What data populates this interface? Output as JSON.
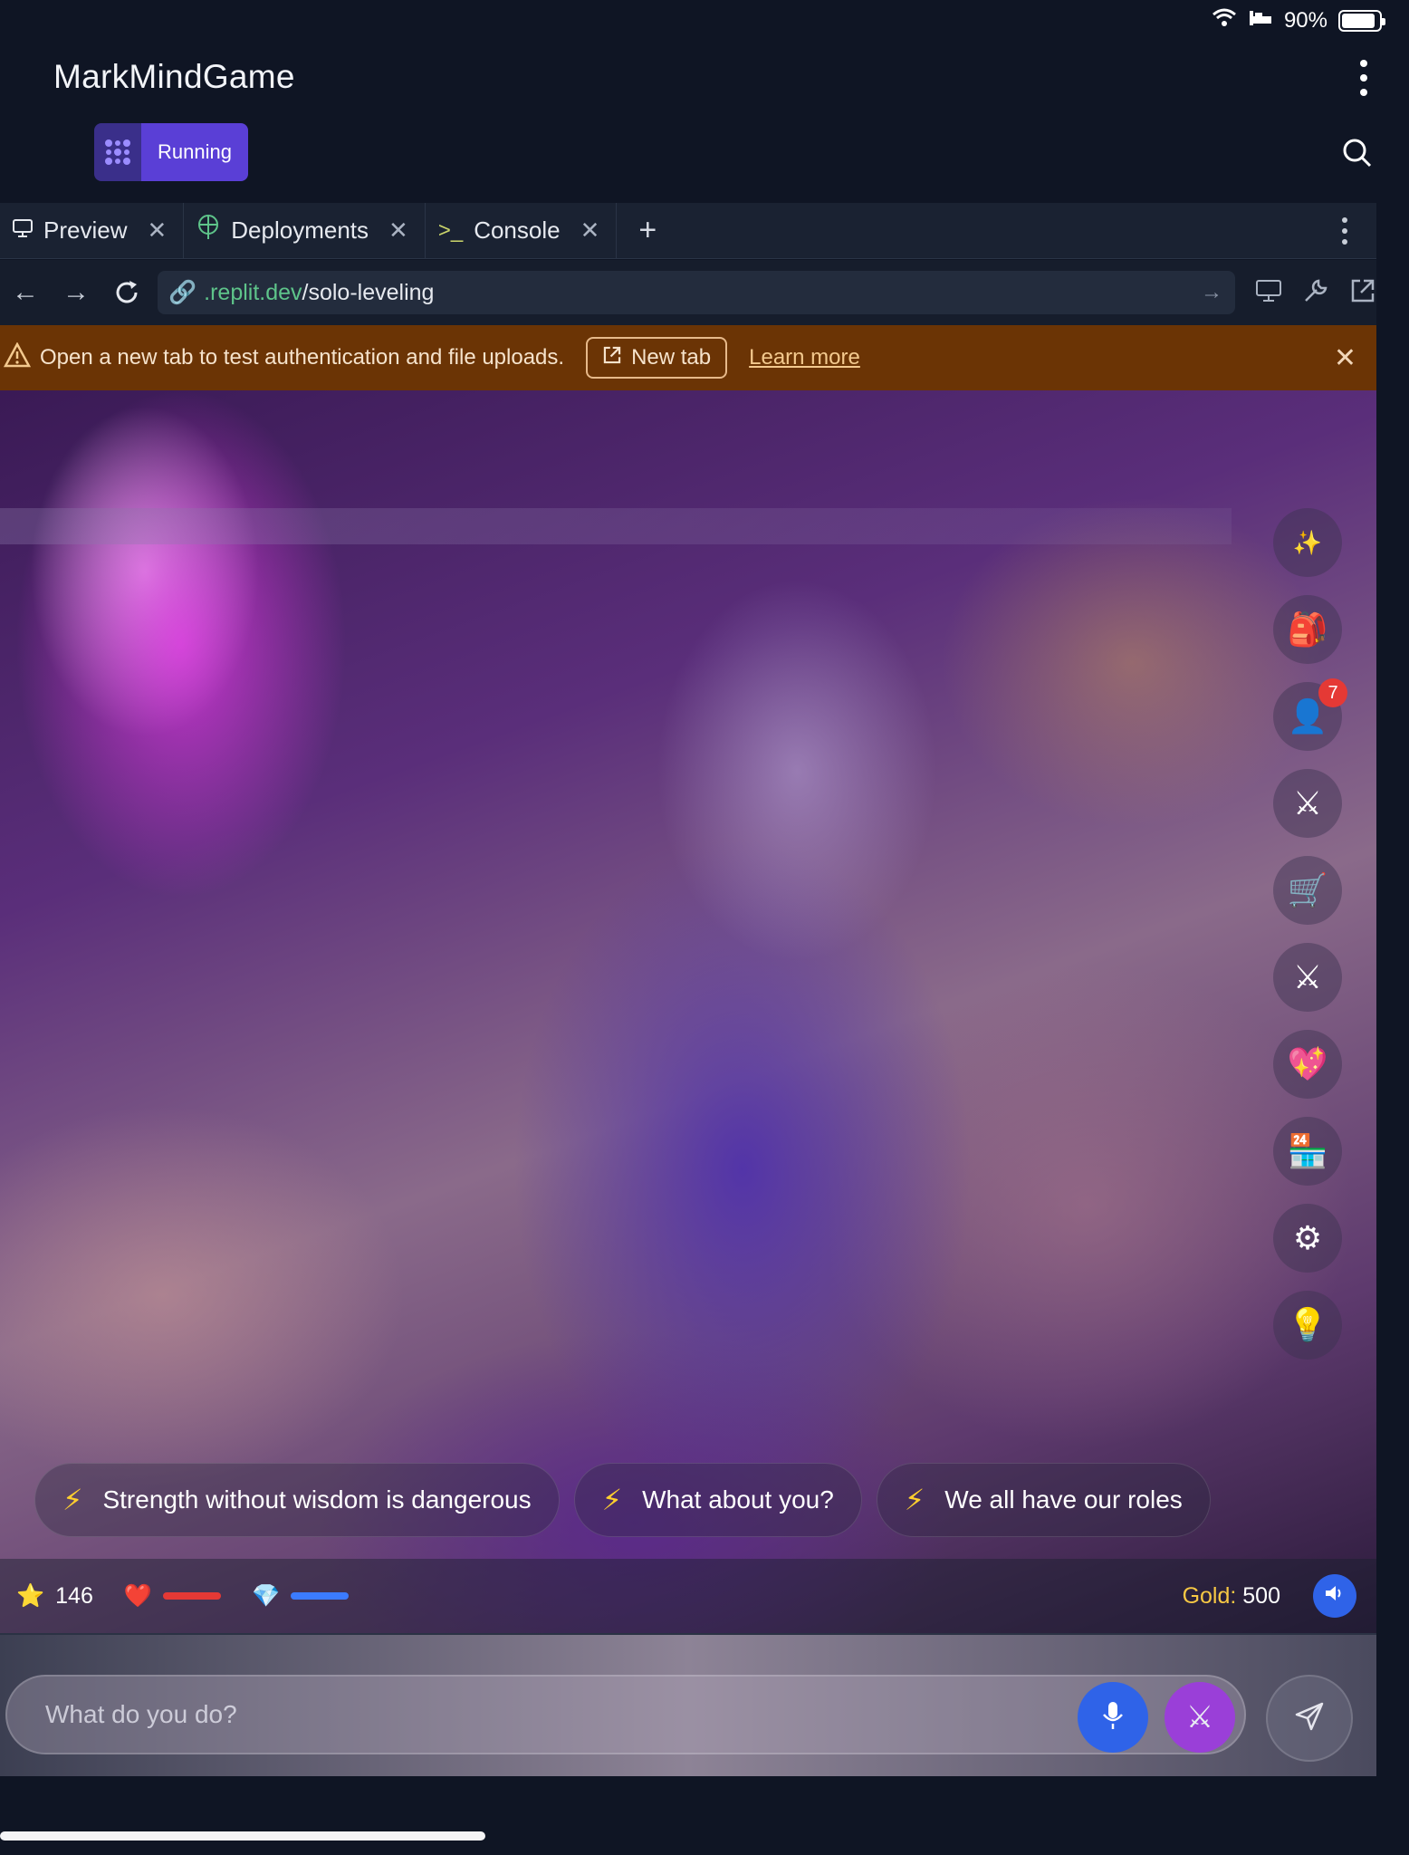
{
  "status_bar": {
    "battery": "90%",
    "battery_level": 0.9
  },
  "app": {
    "title": "MarkMindGame",
    "run_state": "Running"
  },
  "tabs": [
    {
      "label": "Preview",
      "icon": "monitor-icon"
    },
    {
      "label": "Deployments",
      "icon": "deploy-icon"
    },
    {
      "label": "Console",
      "icon": "terminal-icon"
    }
  ],
  "url": {
    "host": ".replit.dev",
    "path": "/solo-leveling"
  },
  "banner": {
    "message": "Open a new tab to test authentication and file uploads.",
    "new_tab": "New tab",
    "learn_more": "Learn more"
  },
  "sidebar_buttons": [
    {
      "name": "sparkle",
      "icon": "✨"
    },
    {
      "name": "backpack",
      "icon": "🎒"
    },
    {
      "name": "profile",
      "icon": "👤",
      "badge": "7"
    },
    {
      "name": "battle",
      "icon": "⚔"
    },
    {
      "name": "shop",
      "icon": "🛒"
    },
    {
      "name": "combat",
      "icon": "⚔"
    },
    {
      "name": "heart",
      "icon": "💖"
    },
    {
      "name": "daily",
      "icon": "🏪"
    },
    {
      "name": "settings",
      "icon": "⚙"
    },
    {
      "name": "hint",
      "icon": "💡"
    }
  ],
  "suggestions": [
    "Strength without wisdom is dangerous",
    "What about you?",
    "We all have our roles"
  ],
  "stats": {
    "stars": "146",
    "health_color": "#e53935",
    "mana_color": "#3b7bff",
    "gold_label": "Gold:",
    "gold_value": "500"
  },
  "input": {
    "placeholder": "What do you do?"
  },
  "colors": {
    "accent": "#5a3fd6",
    "banner": "#6b3405",
    "mic": "#2f63e8",
    "action": "#9a3fd8"
  }
}
